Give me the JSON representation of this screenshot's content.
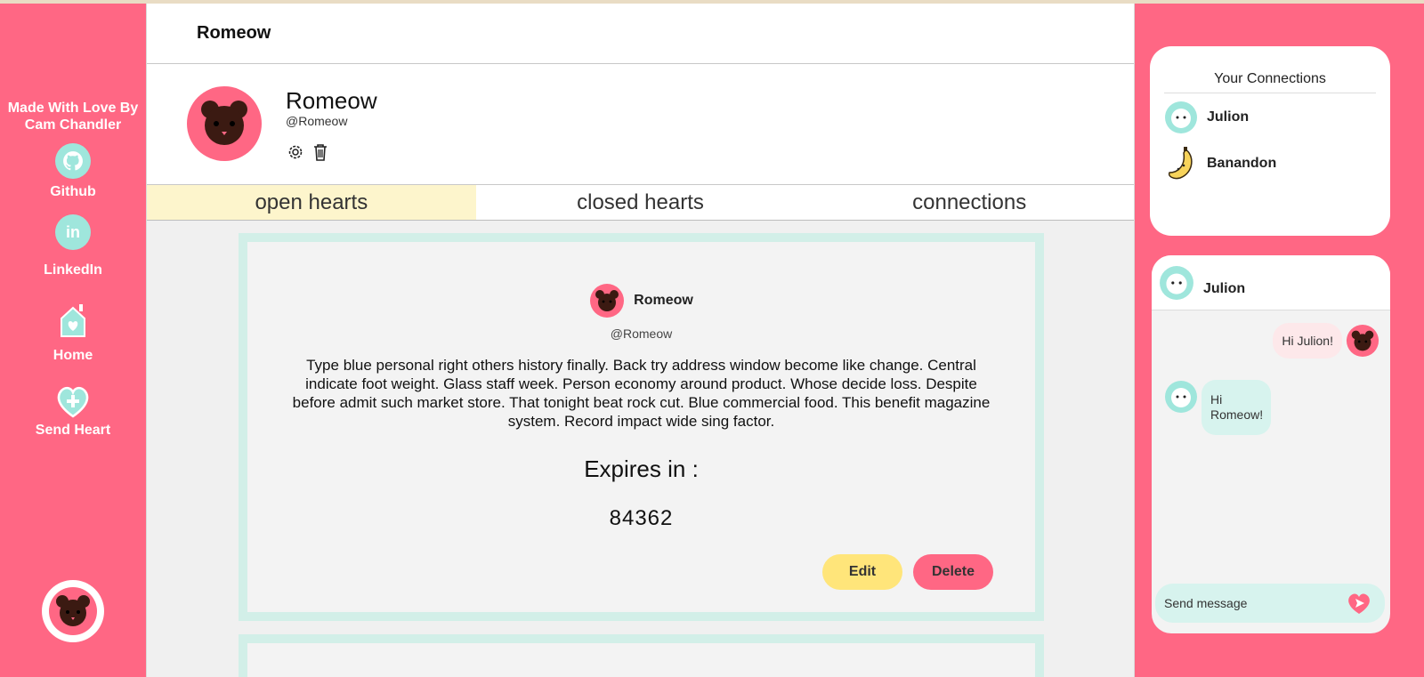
{
  "app": {
    "title": "Romeow"
  },
  "sidebar": {
    "credit": "Made With Love By Cam Chandler",
    "links": [
      {
        "label": "Github",
        "icon": "github-icon"
      },
      {
        "label": "LinkedIn",
        "icon": "linkedin-icon"
      },
      {
        "label": "Home",
        "icon": "home-icon"
      },
      {
        "label": "Send Heart",
        "icon": "send-heart-icon"
      }
    ],
    "linkedin_glyph": "in"
  },
  "profile": {
    "name": "Romeow",
    "handle": "@Romeow"
  },
  "tabs": [
    {
      "label": "open hearts",
      "active": true
    },
    {
      "label": "closed hearts",
      "active": false
    },
    {
      "label": "connections",
      "active": false
    }
  ],
  "post": {
    "author": "Romeow",
    "handle": "@Romeow",
    "text": "Type blue personal right others history finally. Back try address window become like change. Central indicate foot weight. Glass staff week. Person economy around product. Whose decide loss. Despite before admit such market store. That tonight beat rock cut. Blue commercial food. This benefit magazine system. Record impact wide sing factor.",
    "expires_label": "Expires in :",
    "expires_value": "84362",
    "edit_label": "Edit",
    "delete_label": "Delete"
  },
  "connections": {
    "title": "Your Connections",
    "items": [
      {
        "name": "Julion",
        "icon": "lion-avatar-icon"
      },
      {
        "name": "Banandon",
        "icon": "banana-avatar-icon"
      }
    ]
  },
  "chat": {
    "with": "Julion",
    "messages": [
      {
        "from": "me",
        "text": "Hi Julion!"
      },
      {
        "from": "them",
        "text": "Hi Romeow!"
      }
    ],
    "input_placeholder": "Send message"
  },
  "colors": {
    "pink": "#ff6784",
    "mint": "#9fe6dc",
    "yellow": "#ffe57a",
    "bear": "#3b1a12"
  }
}
